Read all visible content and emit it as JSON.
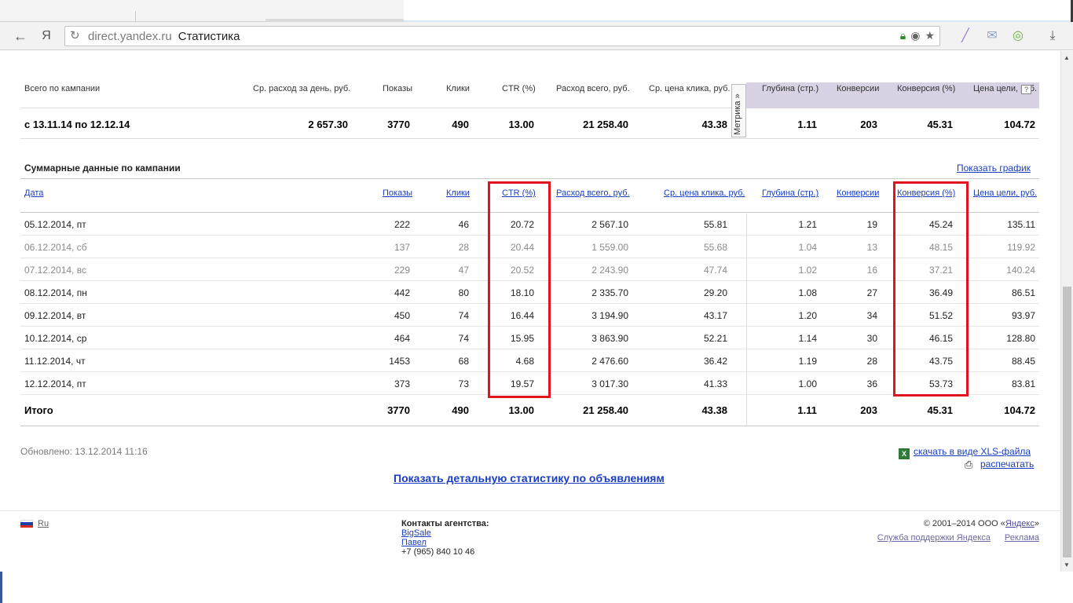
{
  "browser": {
    "back_icon": "←",
    "yandex_icon": "Я",
    "reload_icon": "↻",
    "url_host": "direct.yandex.ru",
    "url_title": "Статистика",
    "download_icon": "⤓"
  },
  "summary": {
    "headers": {
      "label": "Всего по кампании",
      "avg_per_day": "Ср. расход за день, руб.",
      "shows": "Показы",
      "clicks": "Клики",
      "ctr": "CTR (%)",
      "spend": "Расход всего, руб.",
      "avg_cpc": "Ср. цена клика, руб.",
      "depth": "Глубина (стр.)",
      "conversions": "Конверсии",
      "conv_rate": "Конверсия (%)",
      "goal_price": "Цена цели, руб."
    },
    "metrika_label": "Метрика »",
    "help_label": "?",
    "row": {
      "period": "с 13.11.14 по 12.12.14",
      "avg_per_day": "2 657.30",
      "shows": "3770",
      "clicks": "490",
      "ctr": "13.00",
      "spend": "21 258.40",
      "avg_cpc": "43.38",
      "depth": "1.11",
      "conversions": "203",
      "conv_rate": "45.31",
      "goal_price": "104.72"
    }
  },
  "daily": {
    "title": "Суммарные данные по кампании",
    "show_graph": "Показать график",
    "headers": {
      "date": "Дата",
      "shows": "Показы",
      "clicks": "Клики",
      "ctr": "CTR (%)",
      "spend": "Расход всего, руб.",
      "avg_cpc": "Ср. цена клика, руб.",
      "depth": "Глубина (стр.)",
      "conversions": "Конверсии",
      "conv_rate": "Конверсия (%)",
      "goal_price": "Цена цели, руб."
    },
    "rows": [
      {
        "date": "05.12.2014, пт",
        "shows": "222",
        "clicks": "46",
        "ctr": "20.72",
        "spend": "2 567.10",
        "avg_cpc": "55.81",
        "depth": "1.21",
        "conversions": "19",
        "conv_rate": "45.24",
        "goal_price": "135.11",
        "weekend": false
      },
      {
        "date": "06.12.2014, сб",
        "shows": "137",
        "clicks": "28",
        "ctr": "20.44",
        "spend": "1 559.00",
        "avg_cpc": "55.68",
        "depth": "1.04",
        "conversions": "13",
        "conv_rate": "48.15",
        "goal_price": "119.92",
        "weekend": true
      },
      {
        "date": "07.12.2014, вс",
        "shows": "229",
        "clicks": "47",
        "ctr": "20.52",
        "spend": "2 243.90",
        "avg_cpc": "47.74",
        "depth": "1.02",
        "conversions": "16",
        "conv_rate": "37.21",
        "goal_price": "140.24",
        "weekend": true
      },
      {
        "date": "08.12.2014, пн",
        "shows": "442",
        "clicks": "80",
        "ctr": "18.10",
        "spend": "2 335.70",
        "avg_cpc": "29.20",
        "depth": "1.08",
        "conversions": "27",
        "conv_rate": "36.49",
        "goal_price": "86.51",
        "weekend": false
      },
      {
        "date": "09.12.2014, вт",
        "shows": "450",
        "clicks": "74",
        "ctr": "16.44",
        "spend": "3 194.90",
        "avg_cpc": "43.17",
        "depth": "1.20",
        "conversions": "34",
        "conv_rate": "51.52",
        "goal_price": "93.97",
        "weekend": false
      },
      {
        "date": "10.12.2014, ср",
        "shows": "464",
        "clicks": "74",
        "ctr": "15.95",
        "spend": "3 863.90",
        "avg_cpc": "52.21",
        "depth": "1.14",
        "conversions": "30",
        "conv_rate": "46.15",
        "goal_price": "128.80",
        "weekend": false
      },
      {
        "date": "11.12.2014, чт",
        "shows": "1453",
        "clicks": "68",
        "ctr": "4.68",
        "spend": "2 476.60",
        "avg_cpc": "36.42",
        "depth": "1.19",
        "conversions": "28",
        "conv_rate": "43.75",
        "goal_price": "88.45",
        "weekend": false
      },
      {
        "date": "12.12.2014, пт",
        "shows": "373",
        "clicks": "73",
        "ctr": "19.57",
        "spend": "3 017.30",
        "avg_cpc": "41.33",
        "depth": "1.00",
        "conversions": "36",
        "conv_rate": "53.73",
        "goal_price": "83.81",
        "weekend": false
      }
    ],
    "total": {
      "label": "Итого",
      "shows": "3770",
      "clicks": "490",
      "ctr": "13.00",
      "spend": "21 258.40",
      "avg_cpc": "43.38",
      "depth": "1.11",
      "conversions": "203",
      "conv_rate": "45.31",
      "goal_price": "104.72"
    }
  },
  "actions": {
    "updated": "Обновлено: 13.12.2014 11:16",
    "xls_label": "скачать в виде XLS-файла",
    "print_label": "распечатать",
    "detail_label": "Показать детальную статистику по объявлениям"
  },
  "footer": {
    "lang": "Ru",
    "contacts_title": "Контакты агентства:",
    "contact_1": "BigSale",
    "contact_2": "Павел",
    "phone": "+7 (965) 840 10 46",
    "copyright_prefix": "© 2001–2014  ООО «",
    "copyright_link": "Яндекс",
    "copyright_suffix": "»",
    "support": "Служба поддержки Яндекса",
    "ads": "Реклама"
  },
  "colors": {
    "highlight_red": "#e0141e",
    "link_blue": "#1a3dc1",
    "lilac_header": "#d8d2e4"
  }
}
